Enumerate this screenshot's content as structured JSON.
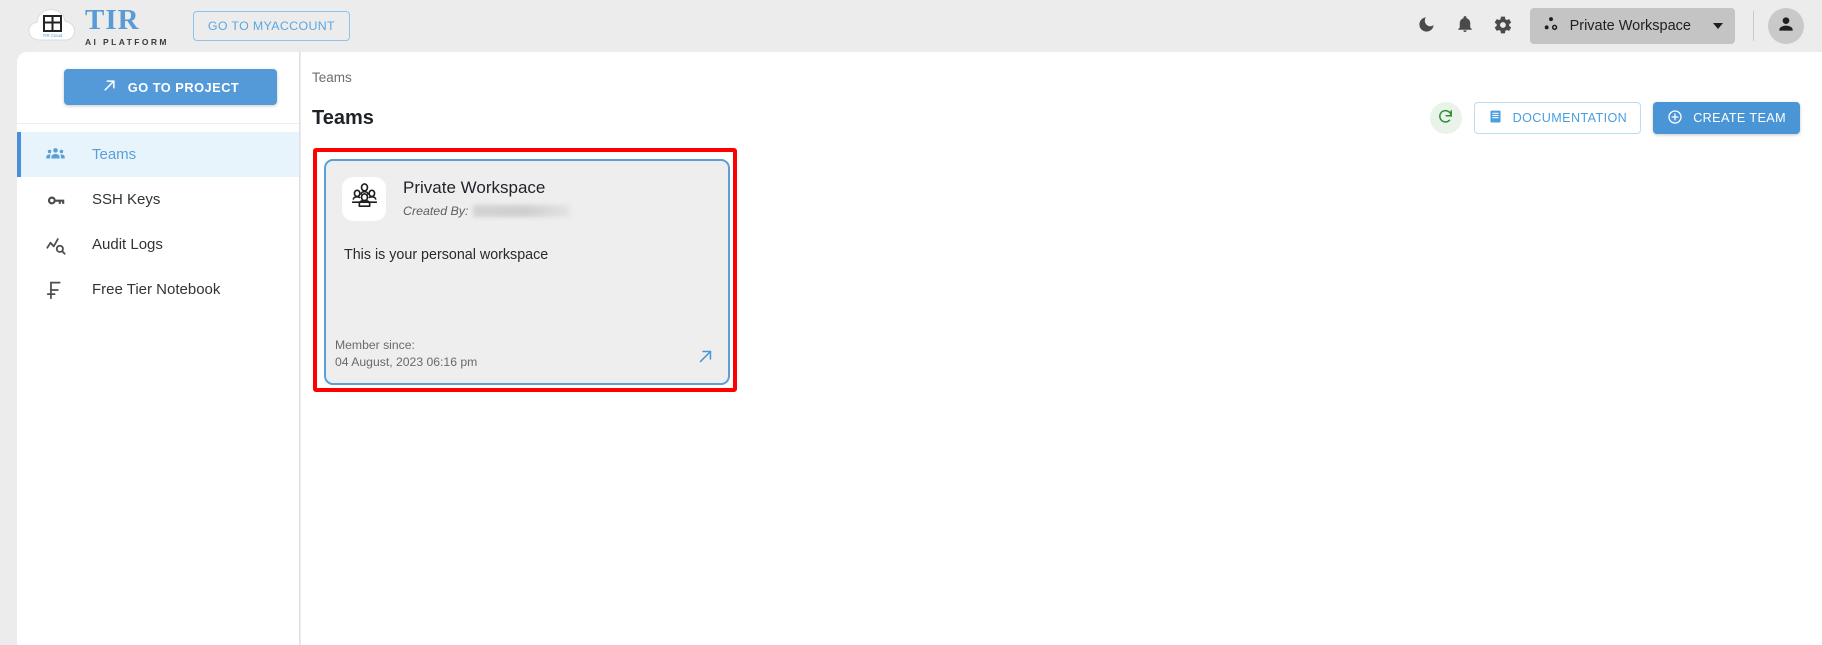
{
  "topbar": {
    "brand_name": "TIR",
    "brand_subtitle": "AI PLATFORM",
    "myaccount_label": "GO TO MYACCOUNT",
    "dark_mode_icon": "moon-icon",
    "notifications_icon": "bell-icon",
    "settings_icon": "gear-icon",
    "workspace_label": "Private Workspace",
    "workspace_icon": "workspace-dots-icon",
    "avatar_icon": "user-avatar-icon"
  },
  "sidebar": {
    "go_to_project_label": "GO TO PROJECT",
    "go_to_project_icon": "arrow-up-right-icon",
    "items": [
      {
        "label": "Teams",
        "icon": "people-group-icon",
        "active": true
      },
      {
        "label": "SSH Keys",
        "icon": "key-icon",
        "active": false
      },
      {
        "label": "Audit Logs",
        "icon": "chart-search-icon",
        "active": false
      },
      {
        "label": "Free Tier Notebook",
        "icon": "free-tier-icon",
        "active": false
      }
    ]
  },
  "main": {
    "breadcrumb": "Teams",
    "page_title": "Teams",
    "refresh_icon": "refresh-icon",
    "documentation_label": "DOCUMENTATION",
    "documentation_icon": "document-icon",
    "create_team_label": "CREATE TEAM",
    "create_team_icon": "plus-circle-icon"
  },
  "team_card": {
    "name": "Private Workspace",
    "avatar_icon": "people-group-icon",
    "created_by_label": "Created By:",
    "created_by_value": "",
    "description": "This is your personal workspace",
    "member_since_label": "Member since:",
    "member_since_value": "04 August, 2023 06:16 pm",
    "open_icon": "arrow-up-right-icon"
  },
  "colors": {
    "accent_blue": "#4a95d6",
    "link_blue": "#5a9fd6",
    "highlight_red": "#fe0000",
    "refresh_green": "#2e8b36",
    "page_bg": "#ececec",
    "card_bg": "#eeeeee",
    "active_nav_bg": "#e8f4fc"
  }
}
